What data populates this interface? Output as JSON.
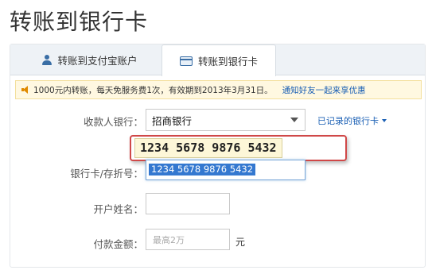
{
  "page": {
    "title": "转账到银行卡"
  },
  "tabs": [
    {
      "label": "转账到支付宝账户",
      "icon": "person-icon",
      "active": false
    },
    {
      "label": "转账到银行卡",
      "icon": "bank-card-icon",
      "active": true
    }
  ],
  "notice": {
    "icon": "speaker-icon",
    "text": "1000元内转账，每天免服务费1次，有效期到2013年3月31日。",
    "link": "通知好友一起来享优惠"
  },
  "form": {
    "payee_bank_label": "收款人银行：",
    "payee_bank_value": "招商银行",
    "saved_cards_link": "已记录的银行卡",
    "card_number_zoom": "1234 5678 9876 5432",
    "card_number_label": "银行卡/存折号：",
    "card_number_value": "1234 5678 9876 5432",
    "account_name_label": "开户姓名：",
    "account_name_value": "",
    "amount_label": "付款金额：",
    "amount_placeholder": "最高2万",
    "amount_unit": "元"
  },
  "colors": {
    "link": "#1a5fb4",
    "highlight_border": "#d04848",
    "notice_bg": "#fff8e1",
    "tab_strip_bg": "#eef2f6",
    "selection": "#3478d0"
  }
}
